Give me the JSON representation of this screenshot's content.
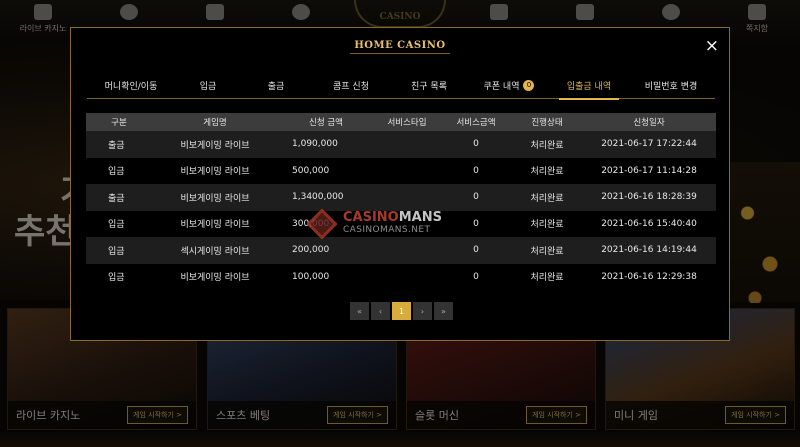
{
  "topnav": {
    "items": [
      {
        "label": "라이브 카지노",
        "icon": "live-casino-icon"
      },
      {
        "label": "",
        "icon": "soccer-ball-icon"
      },
      {
        "label": "",
        "icon": "slot-machine-icon"
      },
      {
        "label": "",
        "icon": "disc-icon"
      },
      {
        "label": "",
        "icon": "logo"
      },
      {
        "label": "",
        "icon": "trophy-icon"
      },
      {
        "label": "",
        "icon": "bell-icon"
      },
      {
        "label": "",
        "icon": "chip-icon"
      },
      {
        "label": "쪽지함",
        "icon": "mail-icon"
      }
    ],
    "brand": "CASINO"
  },
  "hero": {
    "text_line1": "기",
    "text_line2": "추천"
  },
  "cards": [
    {
      "name": "라이브 카지노",
      "button": "게임 시작하기 >"
    },
    {
      "name": "스포츠 베팅",
      "button": "게임 시작하기 >"
    },
    {
      "name": "슬롯 머신",
      "button": "게임 시작하기 >"
    },
    {
      "name": "미니 게임",
      "button": "게임 시작하기 >"
    }
  ],
  "modal": {
    "logo": "HOME CASINO",
    "close": "×",
    "tabs": [
      {
        "label": "머니확인/이동",
        "active": false
      },
      {
        "label": "입금",
        "active": false
      },
      {
        "label": "출금",
        "active": false
      },
      {
        "label": "콤프 신청",
        "active": false
      },
      {
        "label": "친구 목록",
        "active": false
      },
      {
        "label": "쿠폰 내역",
        "active": false,
        "badge": "0"
      },
      {
        "label": "입출금 내역",
        "active": true
      },
      {
        "label": "비밀번호 변경",
        "active": false
      }
    ],
    "table": {
      "headers": [
        "구분",
        "게임명",
        "신청 금액",
        "서비스타입",
        "서비스금액",
        "진행상태",
        "신청일자"
      ],
      "rows": [
        [
          "출금",
          "비보게이밍 라이브",
          "1,090,000",
          "",
          "0",
          "처리완료",
          "2021-06-17 17:22:44"
        ],
        [
          "입금",
          "비보게이밍 라이브",
          "500,000",
          "",
          "0",
          "처리완료",
          "2021-06-17 11:14:28"
        ],
        [
          "출금",
          "비보게이밍 라이브",
          "1,3400,000",
          "",
          "0",
          "처리완료",
          "2021-06-16 18:28:39"
        ],
        [
          "입금",
          "비보게이밍 라이브",
          "300,000",
          "",
          "0",
          "처리완료",
          "2021-06-16 15:40:40"
        ],
        [
          "입금",
          "섹시게이밍 라이브",
          "200,000",
          "",
          "0",
          "처리완료",
          "2021-06-16 14:19:44"
        ],
        [
          "입금",
          "비보게이밍 라이브",
          "100,000",
          "",
          "0",
          "처리완료",
          "2021-06-16 12:29:38"
        ]
      ]
    },
    "pager": {
      "first": "«",
      "prev": "‹",
      "current": "1",
      "next": "›",
      "last": "»"
    }
  },
  "watermark": {
    "main_a": "CASINO",
    "main_b": "MANS",
    "sub": "CASINOMANS.NET"
  },
  "colors": {
    "accent": "#e1b84f",
    "border": "#8a6a28",
    "header_bg": "#3c3c3c"
  }
}
